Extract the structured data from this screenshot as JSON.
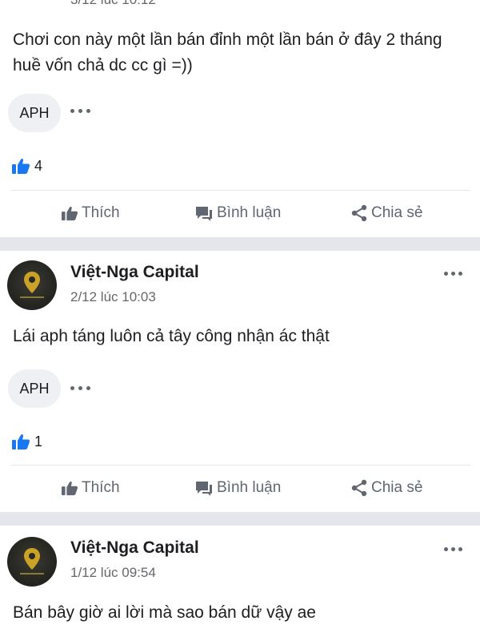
{
  "posts": [
    {
      "timestamp": "3/12 lúc 10:12",
      "content": "Chơi con này một lần bán đỉnh một lần bán ở đây 2 tháng huề vốn chả dc cc gì =))",
      "tag": "APH",
      "like_count": "4"
    },
    {
      "author": "Việt-Nga Capital",
      "timestamp": "2/12 lúc 10:03",
      "content": "Lái aph táng luôn cả tây công nhận ác thật",
      "tag": "APH",
      "like_count": "1"
    },
    {
      "author": "Việt-Nga Capital",
      "timestamp": "1/12 lúc 09:54",
      "content": "Bán bây giờ ai lời mà sao bán dữ vậy ae"
    }
  ],
  "actions": {
    "like": "Thích",
    "comment": "Bình luận",
    "share": "Chia sẻ"
  },
  "icons": {
    "like": "thumbs-up-icon",
    "comment": "comment-icon",
    "share": "share-icon",
    "more": "more-dots-icon"
  },
  "colors": {
    "like_blue": "#1877f2",
    "separator": "#e4e6eb",
    "secondary_text": "#65676b",
    "avatar_gold": "#c9a227"
  }
}
